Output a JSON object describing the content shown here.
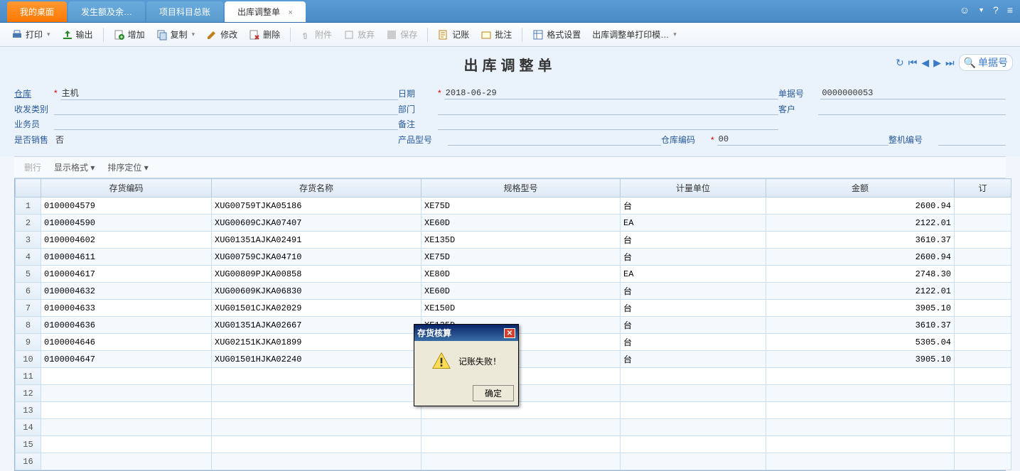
{
  "tabs": [
    {
      "label": "我的桌面",
      "active": "orange"
    },
    {
      "label": "发生额及余…",
      "active": "no"
    },
    {
      "label": "项目科目总账",
      "active": "no"
    },
    {
      "label": "出库调整单",
      "active": "white",
      "close": "×"
    }
  ],
  "toolbar": {
    "print": "打印",
    "export": "输出",
    "add": "增加",
    "copy": "复制",
    "edit": "修改",
    "delete": "删除",
    "attach": "附件",
    "abandon": "放弃",
    "save": "保存",
    "post": "记账",
    "approve": "批注",
    "format": "格式设置",
    "template": "出库调整单打印模…"
  },
  "page_title": "出库调整单",
  "search_placeholder": "单据号",
  "form": {
    "warehouse_label": "仓库",
    "warehouse_value": "主机",
    "date_label": "日期",
    "date_value": "2018-06-29",
    "doc_no_label": "单据号",
    "doc_no_value": "0000000053",
    "cat_label": "收发类别",
    "dept_label": "部门",
    "customer_label": "客户",
    "operator_label": "业务员",
    "remark_label": "备注",
    "is_sale_label": "是否销售",
    "is_sale_value": "否",
    "product_model_label": "产品型号",
    "wh_code_label": "仓库编码",
    "wh_code_value": "00",
    "machine_no_label": "整机编号"
  },
  "grid_toolbar": {
    "delete_row": "删行",
    "display": "显示格式",
    "sort": "排序定位"
  },
  "columns": {
    "code": "存货编码",
    "name": "存货名称",
    "spec": "规格型号",
    "unit": "计量单位",
    "amount": "金额",
    "ext": "订"
  },
  "rows": [
    {
      "n": "1",
      "code": "0100004579",
      "name": "XUG00759TJKA05186",
      "spec": "XE75D",
      "unit": "台",
      "amount": "2600.94"
    },
    {
      "n": "2",
      "code": "0100004590",
      "name": "XUG00609CJKA07407",
      "spec": "XE60D",
      "unit": "EA",
      "amount": "2122.01"
    },
    {
      "n": "3",
      "code": "0100004602",
      "name": "XUG01351AJKA02491",
      "spec": "XE135D",
      "unit": "台",
      "amount": "3610.37"
    },
    {
      "n": "4",
      "code": "0100004611",
      "name": "XUG00759CJKA04710",
      "spec": "XE75D",
      "unit": "台",
      "amount": "2600.94"
    },
    {
      "n": "5",
      "code": "0100004617",
      "name": "XUG00809PJKA00858",
      "spec": "XE80D",
      "unit": "EA",
      "amount": "2748.30"
    },
    {
      "n": "6",
      "code": "0100004632",
      "name": "XUG00609KJKA06830",
      "spec": "XE60D",
      "unit": "台",
      "amount": "2122.01"
    },
    {
      "n": "7",
      "code": "0100004633",
      "name": "XUG01501CJKA02029",
      "spec": "XE150D",
      "unit": "台",
      "amount": "3905.10"
    },
    {
      "n": "8",
      "code": "0100004636",
      "name": "XUG01351AJKA02667",
      "spec": "XE135D",
      "unit": "台",
      "amount": "3610.37"
    },
    {
      "n": "9",
      "code": "0100004646",
      "name": "XUG02151KJKA01899",
      "spec": "",
      "unit": "台",
      "amount": "5305.04"
    },
    {
      "n": "10",
      "code": "0100004647",
      "name": "XUG01501HJKA02240",
      "spec": "",
      "unit": "台",
      "amount": "3905.10"
    },
    {
      "n": "11",
      "code": "",
      "name": "",
      "spec": "",
      "unit": "",
      "amount": ""
    },
    {
      "n": "12",
      "code": "",
      "name": "",
      "spec": "",
      "unit": "",
      "amount": ""
    },
    {
      "n": "13",
      "code": "",
      "name": "",
      "spec": "",
      "unit": "",
      "amount": ""
    },
    {
      "n": "14",
      "code": "",
      "name": "",
      "spec": "",
      "unit": "",
      "amount": ""
    },
    {
      "n": "15",
      "code": "",
      "name": "",
      "spec": "",
      "unit": "",
      "amount": ""
    },
    {
      "n": "16",
      "code": "",
      "name": "",
      "spec": "",
      "unit": "",
      "amount": ""
    }
  ],
  "dialog": {
    "title": "存货核算",
    "message": "记账失败！",
    "ok": "确定"
  }
}
